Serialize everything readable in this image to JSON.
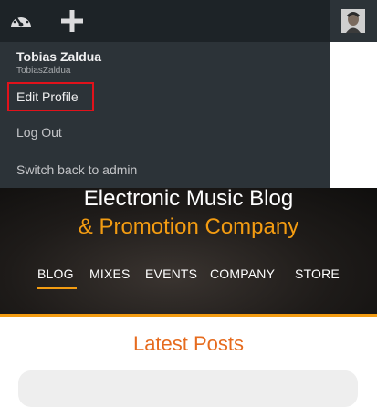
{
  "admin_bar": {
    "icons": [
      "dashboard-icon",
      "plus-icon"
    ]
  },
  "dropdown": {
    "display_name": "Tobias Zaldua",
    "username": "TobiasZaldua",
    "edit_profile": "Edit Profile",
    "log_out": "Log Out",
    "switch_back": "Switch back to admin"
  },
  "hero": {
    "title_line1": "Electronic Music Blog",
    "title_line2": "& Promotion Company",
    "nav": [
      "BLOG",
      "MIXES",
      "EVENTS",
      "COMPANY",
      "STORE"
    ],
    "active_nav": "BLOG"
  },
  "main": {
    "section_title": "Latest Posts"
  },
  "colors": {
    "accent": "#f39c12",
    "admin_bar": "#1d2327",
    "dropdown": "#2c3338",
    "highlight": "#e1121b",
    "section_title": "#e66b1e"
  }
}
